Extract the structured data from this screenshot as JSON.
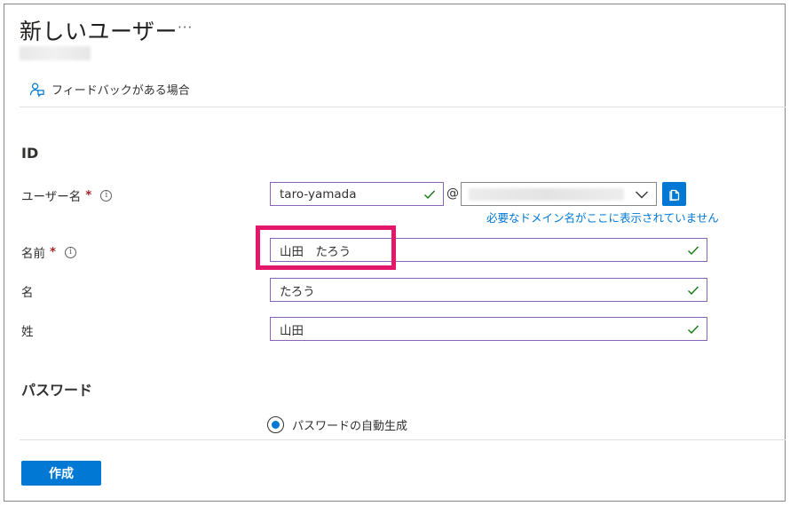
{
  "header": {
    "title": "新しいユーザー",
    "more_label": "···"
  },
  "toolbar": {
    "feedback_label": "フィードバックがある場合"
  },
  "identity_section": {
    "title": "ID",
    "username": {
      "label": "ユーザー名",
      "required_mark": "*",
      "value": "taro-yamada",
      "at": "@",
      "domain_hint": "必要なドメイン名がここに表示されていません"
    },
    "name": {
      "label": "名前",
      "required_mark": "*",
      "value": "山田　たろう"
    },
    "first_name": {
      "label": "名",
      "value": "たろう"
    },
    "last_name": {
      "label": "姓",
      "value": "山田"
    }
  },
  "password_section": {
    "title": "パスワード",
    "auto_generate_label": "パスワードの自動生成",
    "auto_generate_selected": true
  },
  "footer": {
    "create_label": "作成"
  },
  "colors": {
    "accent": "#0078d4",
    "field_border": "#8764b8",
    "valid_check": "#107c10",
    "highlight": "#e4186b",
    "required": "#a4262c"
  }
}
